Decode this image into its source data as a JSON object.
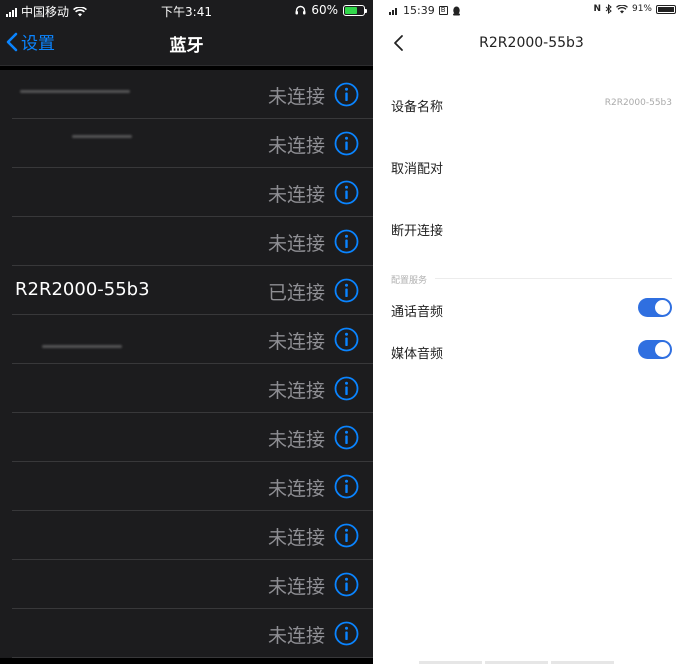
{
  "ios": {
    "statusbar": {
      "carrier": "中国移动",
      "time": "下午3:41",
      "battery": "60%"
    },
    "navbar": {
      "back_label": "设置",
      "title": "蓝牙"
    },
    "devices": [
      {
        "name": "",
        "status": "未连接"
      },
      {
        "name": "",
        "status": "未连接"
      },
      {
        "name": "",
        "status": "未连接"
      },
      {
        "name": "",
        "status": "未连接"
      },
      {
        "name": "R2R2000-55b3",
        "status": "已连接"
      },
      {
        "name": "",
        "status": "未连接"
      },
      {
        "name": "",
        "status": "未连接"
      },
      {
        "name": "",
        "status": "未连接"
      },
      {
        "name": "",
        "status": "未连接"
      },
      {
        "name": "",
        "status": "未连接"
      },
      {
        "name": "",
        "status": "未连接"
      },
      {
        "name": "",
        "status": "未连接"
      }
    ],
    "colors": {
      "accent": "#0a84ff",
      "background": "#000000",
      "cell": "#1c1c1e"
    }
  },
  "android": {
    "statusbar": {
      "time": "15:39",
      "network": "4G",
      "battery": "91%"
    },
    "header": {
      "title": "R2R2000-55b3"
    },
    "device_name": {
      "label": "设备名称",
      "value": "R2R2000-55b3"
    },
    "unpair_label": "取消配对",
    "disconnect_label": "断开连接",
    "section_label": "配置服务",
    "services": [
      {
        "label": "通话音频",
        "enabled": true
      },
      {
        "label": "媒体音频",
        "enabled": true
      }
    ],
    "colors": {
      "accent": "#2f6fe0"
    }
  }
}
